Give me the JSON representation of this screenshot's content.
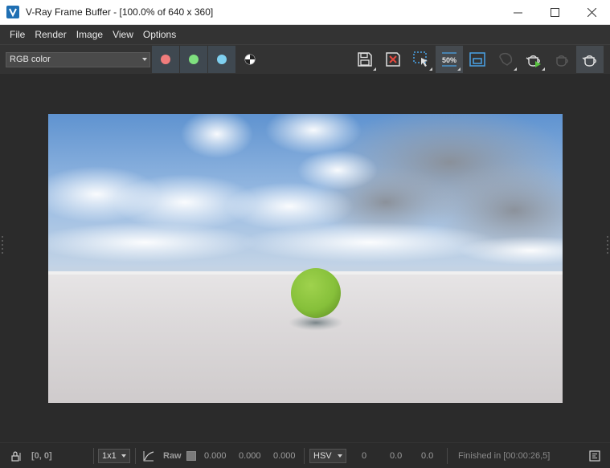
{
  "window": {
    "title": "V-Ray Frame Buffer - [100.0% of 640 x 360]",
    "controls": [
      "minimize-icon",
      "maximize-icon",
      "close-icon"
    ]
  },
  "menu": {
    "items": [
      "File",
      "Render",
      "Image",
      "View",
      "Options"
    ]
  },
  "toolbar": {
    "channel": "RGB color",
    "channel_buttons": [
      {
        "name": "red-channel",
        "color": "#f07c7c",
        "active": true
      },
      {
        "name": "green-channel",
        "color": "#7fe07f",
        "active": true
      },
      {
        "name": "blue-channel",
        "color": "#7fd0f0",
        "active": true
      },
      {
        "name": "alpha-channel",
        "icon": "monochrome-icon",
        "active": false
      }
    ],
    "zoom_badge": "50%",
    "tools": [
      "save-icon",
      "clear-image-icon",
      "region-render-icon",
      "zoom-50-icon",
      "track-mouse-icon",
      "stop-render-icon",
      "render-teapot-icon",
      "interactive-render-icon",
      "render-last-icon"
    ]
  },
  "render": {
    "description_colors": {
      "sky_top": "#6e9fd6",
      "sky_mid": "#a9c6e6",
      "ground": "#d8d6d6",
      "sphere": "#8dc63f"
    }
  },
  "status": {
    "coords": "[0, 0]",
    "sample_size": "1x1",
    "raw_label": "Raw",
    "rgb_values": [
      "0.000",
      "0.000",
      "0.000"
    ],
    "color_mode": "HSV",
    "hsv_values": [
      "0",
      "0.0",
      "0.0"
    ],
    "finished": "Finished in [00:00:26,5]"
  },
  "colors": {
    "accent": "#3c8fd6",
    "toolbar_bg": "#333333",
    "viewport_bg": "#2b2b2b"
  }
}
